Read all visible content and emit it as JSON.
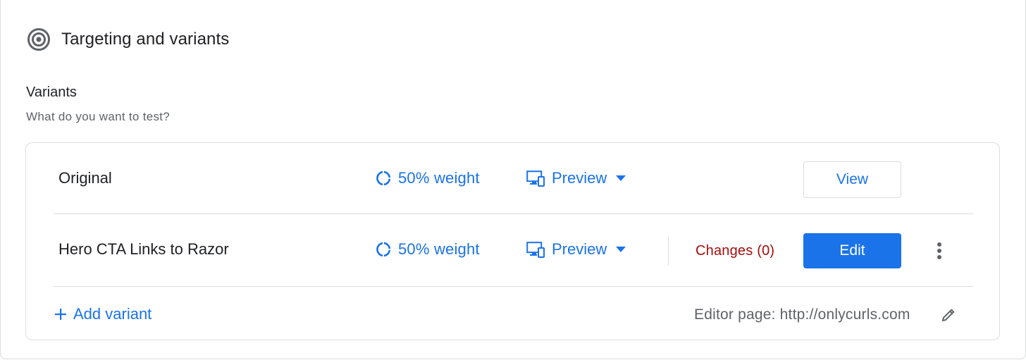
{
  "section": {
    "title": "Targeting and variants",
    "icon": "target-icon"
  },
  "variants": {
    "title": "Variants",
    "description": "What do you want to test?",
    "rows": [
      {
        "name": "Original",
        "weight": "50% weight",
        "preview": "Preview",
        "action": "View"
      },
      {
        "name": "Hero CTA Links to Razor",
        "weight": "50% weight",
        "preview": "Preview",
        "changes": "Changes (0)",
        "action": "Edit"
      }
    ],
    "add_label": "Add variant",
    "editor_page": "Editor page: http://onlycurls.com"
  },
  "colors": {
    "accent": "#1a73e8",
    "changes": "#a50e0e",
    "muted_text": "#5f6368",
    "border": "#dadce0"
  }
}
